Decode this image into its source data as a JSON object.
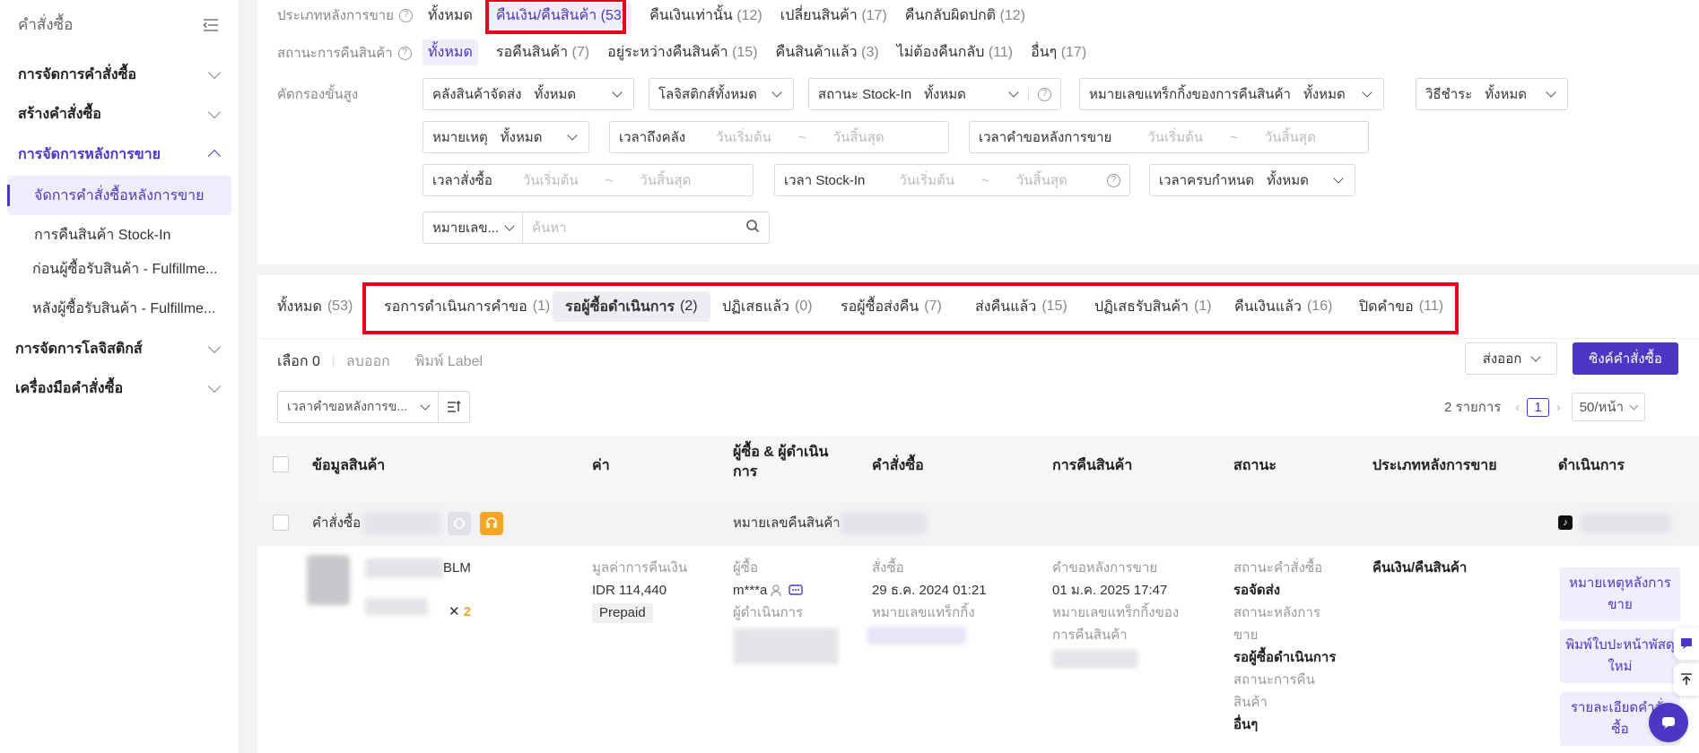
{
  "sidebar": {
    "title": "คำสั่งซื้อ",
    "groups": [
      {
        "label": "การจัดการคำสั่งซื้อ"
      },
      {
        "label": "สร้างคำสั่งซื้อ"
      },
      {
        "label": "การจัดการหลังการขาย"
      },
      {
        "label": "การจัดการโลจิสติกส์"
      },
      {
        "label": "เครื่องมือคำสั่งซื้อ"
      }
    ],
    "subitems": [
      {
        "label": "จัดการคำสั่งซื้อหลังการขาย"
      },
      {
        "label": "การคืนสินค้า Stock-In"
      },
      {
        "label": "ก่อนผู้ซื้อรับสินค้า - Fulfillme..."
      },
      {
        "label": "หลังผู้ซื้อรับสินค้า - Fulfillme..."
      }
    ]
  },
  "filters": {
    "type_label": "ประเภทหลังการขาย",
    "type_options": [
      {
        "label": "ทั้งหมด",
        "count": ""
      },
      {
        "label": "คืนเงิน/คืนสินค้า",
        "count": "(53)"
      },
      {
        "label": "คืนเงินเท่านั้น",
        "count": "(12)"
      },
      {
        "label": "เปลี่ยนสินค้า",
        "count": "(17)"
      },
      {
        "label": "คืนกลับผิดปกติ",
        "count": "(12)"
      }
    ],
    "status_label": "สถานะการคืนสินค้า",
    "status_options": [
      {
        "label": "ทั้งหมด",
        "count": ""
      },
      {
        "label": "รอคืนสินค้า",
        "count": "(7)"
      },
      {
        "label": "อยู่ระหว่างคืนสินค้า",
        "count": "(15)"
      },
      {
        "label": "คืนสินค้าแล้ว",
        "count": "(3)"
      },
      {
        "label": "ไม่ต้องคืนกลับ",
        "count": "(11)"
      },
      {
        "label": "อื่นๆ",
        "count": "(17)"
      }
    ],
    "advanced_label": "คัดกรองขั้นสูง",
    "all": "ทั้งหมด",
    "start": "วันเริ่มต้น",
    "end": "วันสิ้นสุด",
    "tilde": "~",
    "warehouse": "คลังสินค้าจัดส่ง",
    "logistics": "โลจิสติกส์ทั้งหมด",
    "stockin_status": "สถานะ Stock-In",
    "tracking": "หมายเลขแทร็กกิ้งของการคืนสินค้า",
    "payment": "วิธีชำระ",
    "note": "หมายเหตุ",
    "arrive_time": "เวลาถึงคลัง",
    "request_time": "เวลาคำขอหลังการขาย",
    "order_time": "เวลาสั่งซื้อ",
    "stockin_time": "เวลา Stock-In",
    "deadline": "เวลาครบกำหนด",
    "search_type": "หมายเลข...",
    "search_placeholder": "ค้นหา"
  },
  "tabs": [
    {
      "label": "ทั้งหมด",
      "count": "(53)"
    },
    {
      "label": "รอการดำเนินการคำขอ",
      "count": "(1)"
    },
    {
      "label": "รอผู้ซื้อดำเนินการ",
      "count": "(2)"
    },
    {
      "label": "ปฏิเสธแล้ว",
      "count": "(0)"
    },
    {
      "label": "รอผู้ซื้อส่งคืน",
      "count": "(7)"
    },
    {
      "label": "ส่งคืนแล้ว",
      "count": "(15)"
    },
    {
      "label": "ปฏิเสธรับสินค้า",
      "count": "(1)"
    },
    {
      "label": "คืนเงินแล้ว",
      "count": "(16)"
    },
    {
      "label": "ปิดคำขอ",
      "count": "(11)"
    }
  ],
  "toolbar": {
    "selected": "เลือก 0",
    "delete": "ลบออก",
    "print": "พิมพ์ Label",
    "export": "ส่งออก",
    "sync": "ซิงค์คำสั่งซื้อ",
    "sort": "เวลาคำขอหลังการข...",
    "total": "2 รายการ",
    "page": "1",
    "per_page": "50/หน้า"
  },
  "table": {
    "headers": [
      "ข้อมูลสินค้า",
      "ค่า",
      "ผู้ซื้อ & ผู้ดำเนินการ",
      "คำสั่งซื้อ",
      "การคืนสินค้า",
      "สถานะ",
      "ประเภทหลังการขาย",
      "ดำเนินการ"
    ],
    "order_label": "คำสั่งซื้อ",
    "return_no_label": "หมายเลขคืนสินค้า",
    "row": {
      "product_suffix": "BLM",
      "qty": "2",
      "times": "✕",
      "refund_label": "มูลค่าการคืนเงิน",
      "refund_value": "IDR 114,440",
      "prepaid": "Prepaid",
      "buyer_label": "ผู้ซื้อ",
      "buyer": "m***a",
      "operator_label": "ผู้ดำเนินการ",
      "order_time_label": "สั่งซื้อ",
      "order_time": "29 ธ.ค. 2024 01:21",
      "tracking_label": "หมายเลขแทร็กกิ้ง",
      "request_label": "คำขอหลังการขาย",
      "request_time": "01 ม.ค. 2025 17:47",
      "return_tracking_label1": "หมายเลขแทร็กกิ้งของ",
      "return_tracking_label2": "การคืนสินค้า",
      "status_order_label": "สถานะคำสั่งซื้อ",
      "status_order": "รอจัดส่ง",
      "status_after_label1": "สถานะหลังการ",
      "status_after_label2": "ขาย",
      "status_after": "รอผู้ซื้อดำเนินการ",
      "status_return_label1": "สถานะการคืน",
      "status_return_label2": "สินค้า",
      "status_return": "อื่นๆ",
      "type": "คืนเงิน/คืนสินค้า",
      "actions": [
        "หมายเหตุหลังการขาย",
        "พิมพ์ใบปะหน้าพัสดุใหม่",
        "รายละเอียดคำสั่งซื้อ"
      ]
    }
  },
  "colors": {
    "accent": "#4b37c4",
    "highlight": "#e8001c",
    "orange": "#f5a623"
  }
}
